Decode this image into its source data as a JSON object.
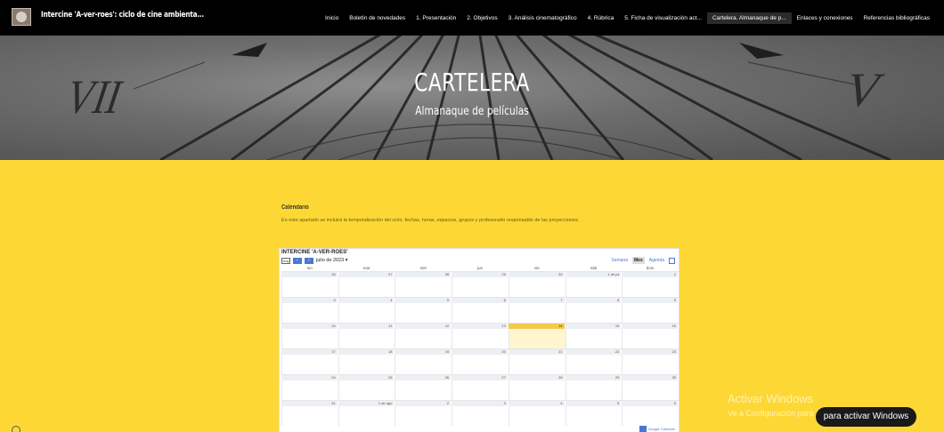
{
  "site": {
    "title": "Intercine 'A-ver-roes': ciclo de cine ambienta..."
  },
  "nav": {
    "items": [
      {
        "label": "Inicio"
      },
      {
        "label": "Boletín de novedades"
      },
      {
        "label": "1. Presentación"
      },
      {
        "label": "2. Objetivos"
      },
      {
        "label": "3. Análisis cinematográfico"
      },
      {
        "label": "4. Rúbrica"
      },
      {
        "label": "5. Ficha de visualización act..."
      },
      {
        "label": "Cartelera. Almanaque de p..."
      },
      {
        "label": "Enlaces y conexiones"
      },
      {
        "label": "Referencias bibliográficas"
      }
    ],
    "active_index": 7
  },
  "hero": {
    "title": "CARTELERA",
    "subtitle": "Almanaque de películas",
    "numeral_left": "VII",
    "numeral_right": "V"
  },
  "content": {
    "heading": "Calendario",
    "text": "En este apartado se incluirá la temporalización del ciclo, fechas, horas, espacios, grupos y profesorado responsable de las proyecciones."
  },
  "calendar": {
    "title": "INTERCINE 'A-VER-ROES'",
    "today_label": "Hoy",
    "month_label": "julio de 2023",
    "views": [
      {
        "label": "Semana",
        "active": false
      },
      {
        "label": "Mes",
        "active": true
      },
      {
        "label": "Agenda",
        "active": false
      }
    ],
    "weekdays": [
      "lun",
      "mar",
      "mié",
      "jue",
      "vie",
      "sáb",
      "dom"
    ],
    "weeks": [
      [
        "26",
        "27",
        "28",
        "29",
        "30",
        "1 de jul",
        "2"
      ],
      [
        "3",
        "4",
        "5",
        "6",
        "7",
        "8",
        "9"
      ],
      [
        "10",
        "11",
        "12",
        "13",
        "14",
        "15",
        "16"
      ],
      [
        "17",
        "18",
        "19",
        "20",
        "21",
        "22",
        "23"
      ],
      [
        "24",
        "25",
        "26",
        "27",
        "28",
        "29",
        "30"
      ],
      [
        "31",
        "1 de ago",
        "2",
        "3",
        "4",
        "5",
        "6"
      ]
    ],
    "today_cell": "14",
    "footer": "Google Calendar"
  },
  "windows": {
    "activate_title": "Activar Windows",
    "activate_sub": "Ve a Configuración para activar Windows."
  },
  "cookie_pill": {
    "label": "para activar Windows"
  }
}
